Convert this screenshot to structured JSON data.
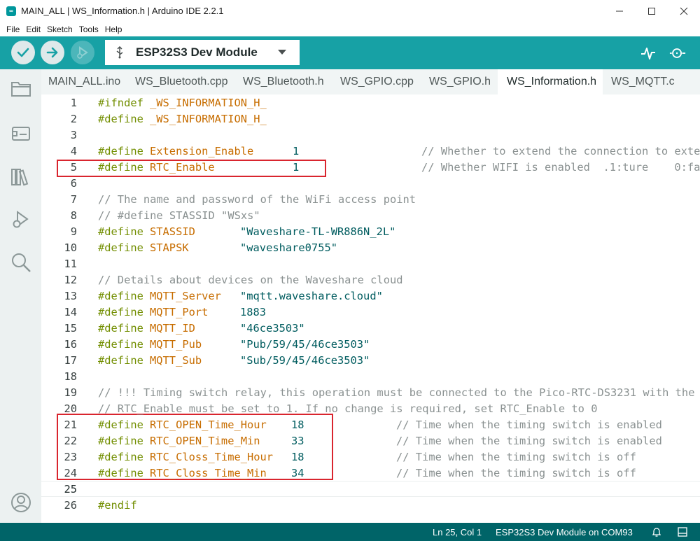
{
  "window": {
    "logo_text": "∞",
    "title": "MAIN_ALL | WS_Information.h | Arduino IDE 2.2.1"
  },
  "menu": [
    "File",
    "Edit",
    "Sketch",
    "Tools",
    "Help"
  ],
  "toolbar": {
    "board": "ESP32S3 Dev Module"
  },
  "tabs": [
    {
      "label": "MAIN_ALL.ino",
      "active": false
    },
    {
      "label": "WS_Bluetooth.cpp",
      "active": false
    },
    {
      "label": "WS_Bluetooth.h",
      "active": false
    },
    {
      "label": "WS_GPIO.cpp",
      "active": false
    },
    {
      "label": "WS_GPIO.h",
      "active": false
    },
    {
      "label": "WS_Information.h",
      "active": true
    },
    {
      "label": "WS_MQTT.c",
      "active": false
    }
  ],
  "editor": {
    "current_line": 25,
    "lines": [
      {
        "n": "1",
        "kw": "#ifndef",
        "name": "_WS_INFORMATION_H_",
        "value": "",
        "comment": ""
      },
      {
        "n": "2",
        "kw": "#define",
        "name": "_WS_INFORMATION_H_",
        "value": "",
        "comment": ""
      },
      {
        "n": "3",
        "kw": "",
        "name": "",
        "value": "",
        "comment": ""
      },
      {
        "n": "4",
        "kw": "#define",
        "name": "Extension_Enable",
        "value": "1",
        "comment": "// Whether to extend the connection to exte"
      },
      {
        "n": "5",
        "kw": "#define",
        "name": "RTC_Enable",
        "value": "1",
        "comment": "// Whether WIFI is enabled  .1:ture    0:fa"
      },
      {
        "n": "6",
        "kw": "",
        "name": "",
        "value": "",
        "comment": ""
      },
      {
        "n": "7",
        "kw": "",
        "name": "",
        "value": "",
        "comment": "// The name and password of the WiFi access point"
      },
      {
        "n": "8",
        "kw": "",
        "name": "",
        "value": "",
        "comment": "// #define STASSID \"WSxs\""
      },
      {
        "n": "9",
        "kw": "#define",
        "name": "STASSID",
        "value": "\"Waveshare-TL-WR886N_2L\"",
        "comment": ""
      },
      {
        "n": "10",
        "kw": "#define",
        "name": "STAPSK",
        "value": "\"waveshare0755\"",
        "comment": ""
      },
      {
        "n": "11",
        "kw": "",
        "name": "",
        "value": "",
        "comment": ""
      },
      {
        "n": "12",
        "kw": "",
        "name": "",
        "value": "",
        "comment": "// Details about devices on the Waveshare cloud"
      },
      {
        "n": "13",
        "kw": "#define",
        "name": "MQTT_Server",
        "value": "\"mqtt.waveshare.cloud\"",
        "comment": ""
      },
      {
        "n": "14",
        "kw": "#define",
        "name": "MQTT_Port",
        "value": "1883",
        "comment": ""
      },
      {
        "n": "15",
        "kw": "#define",
        "name": "MQTT_ID",
        "value": "\"46ce3503\"",
        "comment": ""
      },
      {
        "n": "16",
        "kw": "#define",
        "name": "MQTT_Pub",
        "value": "\"Pub/59/45/46ce3503\"",
        "comment": ""
      },
      {
        "n": "17",
        "kw": "#define",
        "name": "MQTT_Sub",
        "value": "\"Sub/59/45/46ce3503\"",
        "comment": ""
      },
      {
        "n": "18",
        "kw": "",
        "name": "",
        "value": "",
        "comment": ""
      },
      {
        "n": "19",
        "kw": "",
        "name": "",
        "value": "",
        "comment": "// !!! Timing switch relay, this operation must be connected to the Pico-RTC-DS3231 with the"
      },
      {
        "n": "20",
        "kw": "",
        "name": "",
        "value": "",
        "comment": "// RTC_Enable must be set to 1. If no change is required, set RTC_Enable to 0"
      },
      {
        "n": "21",
        "kw": "#define",
        "name": "RTC_OPEN_Time_Hour",
        "value": "18",
        "comment": "// Time when the timing switch is enabled"
      },
      {
        "n": "22",
        "kw": "#define",
        "name": "RTC_OPEN_Time_Min",
        "value": "33",
        "comment": "// Time when the timing switch is enabled"
      },
      {
        "n": "23",
        "kw": "#define",
        "name": "RTC_Closs_Time_Hour",
        "value": "18",
        "comment": "// Time when the timing switch is off"
      },
      {
        "n": "24",
        "kw": "#define",
        "name": "RTC_Closs_Time_Min",
        "value": "34",
        "comment": "// Time when the timing switch is off"
      },
      {
        "n": "25",
        "kw": "",
        "name": "",
        "value": "",
        "comment": ""
      },
      {
        "n": "26",
        "kw": "#endif",
        "name": "",
        "value": "",
        "comment": ""
      }
    ]
  },
  "statusbar": {
    "position": "Ln 25, Col 1",
    "board_port": "ESP32S3 Dev Module on COM93"
  },
  "colors": {
    "toolbar": "#17a1a5",
    "statusbar": "#006468",
    "highlight_box": "#d9252e",
    "keyword": "#728e00",
    "macro_name": "#c76d00",
    "literal": "#005c5f",
    "comment": "#8a9191"
  },
  "icons": {
    "toolbar": [
      "verify-icon",
      "upload-icon",
      "debug-icon",
      "usb-icon",
      "serial-plotter-icon",
      "serial-monitor-icon"
    ],
    "sidebar": [
      "sketchbook-folder-icon",
      "boards-manager-icon",
      "library-manager-icon",
      "debug-icon",
      "search-icon",
      "profile-icon"
    ],
    "statusbar": [
      "bell-icon",
      "panel-icon"
    ]
  }
}
